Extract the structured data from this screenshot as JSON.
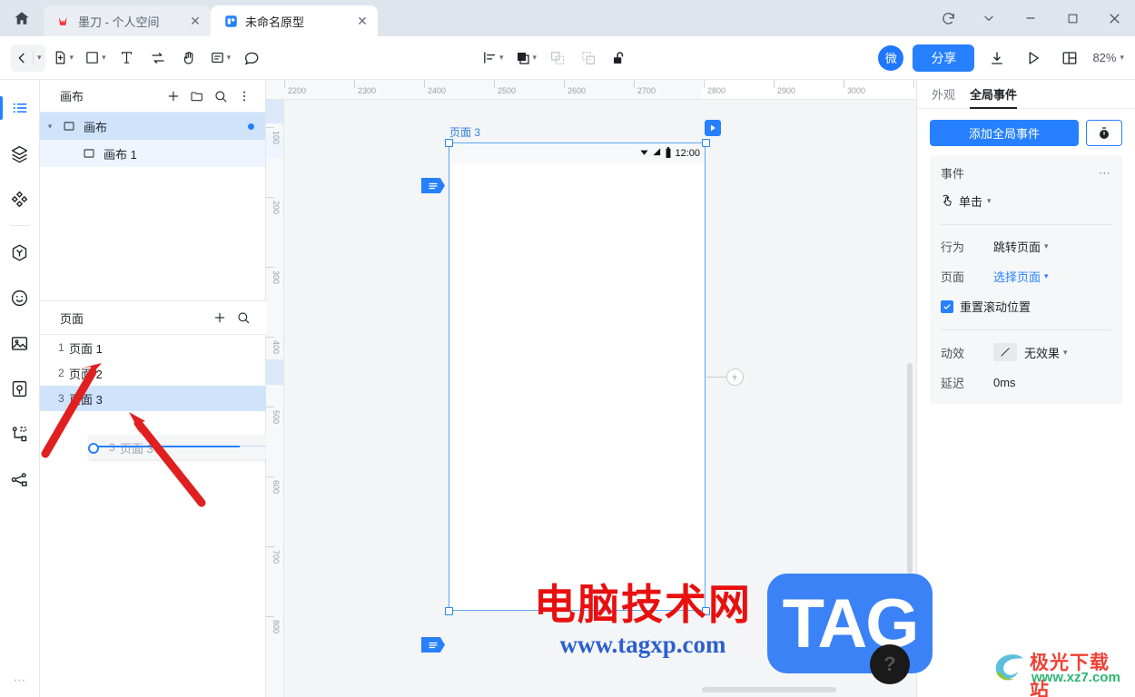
{
  "window": {
    "home_icon": "home-icon",
    "tabs": [
      {
        "favicon": "modao-logo-icon",
        "title": "墨刀 - 个人空间",
        "close": "✕",
        "active": false
      },
      {
        "favicon": "prototype-file-icon",
        "title": "未命名原型",
        "close": "✕",
        "active": true
      }
    ],
    "controls": {
      "refresh": "refresh-icon",
      "chevron": "chevron-down-icon",
      "minimize": "—",
      "maximize": "□",
      "close": "✕"
    }
  },
  "toolbar": {
    "back": "back-arrow-icon",
    "back_caret": "▾",
    "insert": "add-page-icon",
    "insert_caret": "▾",
    "shape": "rectangle-icon",
    "shape_caret": "▾",
    "text": "T",
    "connect": "swap-icon",
    "hand": "hand-icon",
    "note": "note-icon",
    "note_caret": "▾",
    "comment": "comment-bubble-icon",
    "align": "align-left-icon",
    "align_caret": "▾",
    "group": "frame-icon",
    "group_caret": "▾",
    "combine": "combine-icon",
    "subtract": "subtract-icon",
    "lock": "unlock-icon",
    "avatar_label": "微",
    "share_label": "分享",
    "download": "download-icon",
    "preview": "play-icon",
    "layout": "panel-layout-icon",
    "zoom_value": "82%",
    "zoom_caret": "▾"
  },
  "rail": {
    "items": [
      {
        "name": "list-icon",
        "active": true
      },
      {
        "name": "layers-icon",
        "active": false
      },
      {
        "name": "components-icon",
        "active": false
      },
      {
        "name": "divider",
        "active": false
      },
      {
        "name": "widgets-icon",
        "active": false
      },
      {
        "name": "icon-library-icon",
        "active": false
      },
      {
        "name": "image-icon",
        "active": false
      },
      {
        "name": "resource-icon",
        "active": false
      },
      {
        "name": "flow-icon",
        "active": false
      },
      {
        "name": "share-node-icon",
        "active": false
      }
    ],
    "more": "⋯"
  },
  "canvas_panel": {
    "title": "画布",
    "actions": [
      "add-icon",
      "folder-icon",
      "search-icon",
      "more-icon"
    ],
    "tree": [
      {
        "label": "画布",
        "depth": 0,
        "expanded": true,
        "selected": true,
        "dot": true
      },
      {
        "label": "画布 1",
        "depth": 1,
        "expanded": false,
        "selected": false,
        "dot": false
      }
    ]
  },
  "pages_panel": {
    "title": "页面",
    "actions": [
      "add-icon",
      "search-icon"
    ],
    "pages": [
      {
        "num": "1",
        "label": "页面 1",
        "selected": false
      },
      {
        "num": "2",
        "label": "页面 2",
        "selected": false
      },
      {
        "num": "3",
        "label": "页面 3",
        "selected": true
      }
    ],
    "drag_ghost": {
      "num": "3",
      "label": "页面 3"
    }
  },
  "ruler": {
    "h_labels": [
      "2200",
      "2300",
      "2400",
      "2500",
      "2600",
      "2700",
      "2800",
      "2900",
      "3000"
    ],
    "v_labels": [
      "100",
      "200",
      "300",
      "400",
      "500",
      "600",
      "700",
      "800"
    ]
  },
  "artboard": {
    "label": "页面 3",
    "play_icon": "play-icon",
    "status_time": "12:00",
    "status_icons": [
      "wifi-icon",
      "signal-icon",
      "battery-icon"
    ],
    "tag_icon_top": "note-tag-icon",
    "tag_icon_bottom": "note-tag-icon",
    "link_icon": "lightning-icon"
  },
  "right_panel": {
    "tabs": [
      {
        "label": "外观",
        "active": false
      },
      {
        "label": "全局事件",
        "active": true
      }
    ],
    "add_event_label": "添加全局事件",
    "timer_icon": "timer-icon",
    "event": {
      "title": "事件",
      "more": "⋯",
      "trigger_icon": "click-icon",
      "trigger_label": "单击",
      "trigger_caret": "▾",
      "rows": [
        {
          "label": "行为",
          "value": "跳转页面",
          "caret": "▾",
          "link": false
        },
        {
          "label": "页面",
          "value": "选择页面",
          "caret": "▾",
          "link": true
        }
      ],
      "checkbox_label": "重置滚动位置",
      "checkbox_checked": true,
      "anim_label": "动效",
      "anim_value": "无效果",
      "anim_caret": "▾",
      "anim_icon": "diagonal-line-icon",
      "delay_label": "延迟",
      "delay_value": "0ms"
    }
  },
  "watermarks": {
    "wm1_line1": "电脑技术网",
    "wm1_line2": "www.tagxp.com",
    "tag_logo": "TAG",
    "question_mark": "?",
    "jg_line1": "极光下载站",
    "jg_line2": "www.xz7.com"
  },
  "colors": {
    "accent": "#2680ff",
    "titlebar": "#dfe5ec",
    "selection": "#cfe3fb",
    "canvas_bg": "#f4f5f6",
    "watermark_red": "#e8100f",
    "watermark_blue": "#2c5fd0"
  }
}
